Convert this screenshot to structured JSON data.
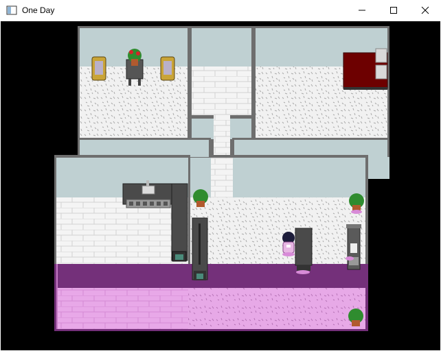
{
  "window": {
    "title": "One Day",
    "controls": {
      "minimize": "minimize-icon",
      "maximize": "maximize-icon",
      "close": "close-icon"
    }
  },
  "colors": {
    "wall": "#bfd0d2",
    "frame": "#6e6e6e",
    "carpet": "#f1f1f1",
    "brick": "#f4f4f4",
    "pink_floor": "#e8a8e8",
    "dark_furniture": "#4a4a4a",
    "bed_red": "#6d0000",
    "chair_gold": "#c9a437",
    "plant_green": "#2f8c2f"
  },
  "scene": {
    "rooms": [
      "top-left-room",
      "top-middle-hall",
      "top-right-bedroom",
      "kitchen",
      "living-room"
    ],
    "objects": [
      "armchair",
      "plant-table",
      "armchair",
      "bed",
      "kitchen-counter",
      "sink",
      "stove",
      "potted-plant",
      "potted-plant",
      "potted-plant",
      "fridge-bench",
      "coffee-table",
      "player-character",
      "cabinet"
    ]
  }
}
